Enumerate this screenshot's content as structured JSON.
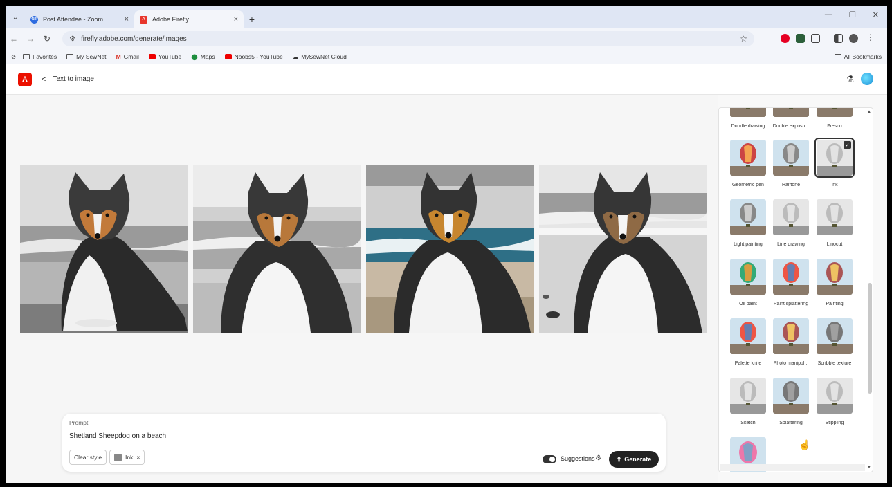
{
  "browser": {
    "tabs": [
      {
        "title": "Post Attendee - Zoom",
        "fav_text": "GT",
        "fav_color": "#2d6be0"
      },
      {
        "title": "Adobe Firefly",
        "fav_text": "A",
        "fav_color": "#e8362c"
      }
    ],
    "new_tab": "+",
    "url": "firefly.adobe.com/generate/images",
    "bookmarks": [
      {
        "label": "Favorites",
        "kind": "folder"
      },
      {
        "label": "My SewNet",
        "kind": "folder"
      },
      {
        "label": "Gmail",
        "kind": "gmail"
      },
      {
        "label": "YouTube",
        "kind": "youtube"
      },
      {
        "label": "Maps",
        "kind": "maps"
      },
      {
        "label": "Noobs5 - YouTube",
        "kind": "youtube"
      },
      {
        "label": "MySewNet Cloud",
        "kind": "cloud"
      }
    ],
    "all_bookmarks": "All Bookmarks"
  },
  "app": {
    "logo": "A",
    "back": "<",
    "page_title": "Text to image",
    "brand_color": "#eb1000"
  },
  "prompt": {
    "label": "Prompt",
    "text": "Shetland Sheepdog on a beach",
    "clear_style": "Clear style",
    "style_chip": "Ink",
    "style_chip_x": "×",
    "suggestions": "Suggestions",
    "generate": "Generate"
  },
  "styles": {
    "rows": [
      [
        "Doodle drawing",
        "Double exposu...",
        "Fresco"
      ],
      [
        "Geometric pen",
        "Halftone",
        "Ink"
      ],
      [
        "Light painting",
        "Line drawing",
        "Linocut"
      ],
      [
        "Oil paint",
        "Paint splattering",
        "Painting"
      ],
      [
        "Palette knife",
        "Photo manipul...",
        "Scribble texture"
      ],
      [
        "Sketch",
        "Splattering",
        "Stippling"
      ]
    ],
    "selected": "Ink"
  }
}
